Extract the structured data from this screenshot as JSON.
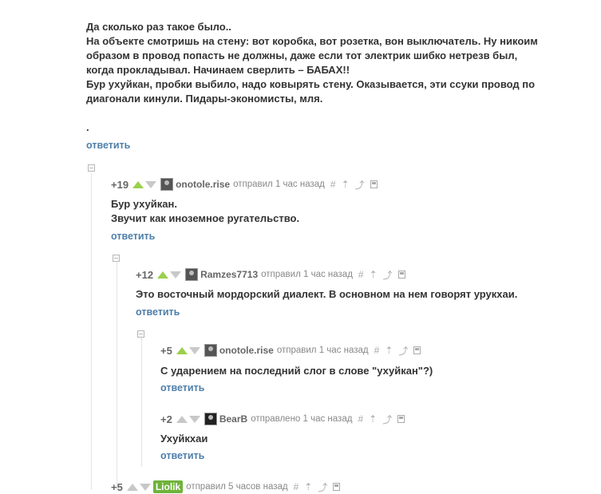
{
  "top_post": {
    "lines": [
      "Да сколько раз такое было..",
      "На объекте смотришь на стену: вот коробка, вот розетка, вон выключатель. Ну никоим",
      "образом в провод попасть не должны, даже если тот электрик шибко нетрезв был,",
      "когда прокладывал. Начинаем сверлить – БАБАХ!!",
      "Бур ухуйкан, пробки выбило, надо ковырять стену. Оказывается, эти ссуки провод по",
      "диагонали кинули. Пидары-экономисты, мля."
    ],
    "dot": ".",
    "reply_label": "ответить"
  },
  "comments": [
    {
      "rating": "+19",
      "username": "onotole.rise",
      "sent_label": "отправил 1 час назад",
      "lines": [
        "Бур ухуйкан.",
        "Звучит как иноземное ругательство."
      ],
      "reply_label": "ответить"
    },
    {
      "rating": "+12",
      "username": "Ramzes7713",
      "sent_label": "отправил 1 час назад",
      "lines": [
        "Это восточный мордорский диалект. В основном на нем говорят урукхаи."
      ],
      "reply_label": "ответить"
    },
    {
      "rating": "+5",
      "username": "onotole.rise",
      "sent_label": "отправил 1 час назад",
      "lines": [
        "С ударением на последний слог в слове \"ухуйкан\"?)"
      ],
      "reply_label": "ответить"
    },
    {
      "rating": "+2",
      "username": "BearB",
      "sent_label": "отправлено 1 час назад",
      "lines": [
        "Ухуйкхаи"
      ],
      "reply_label": "ответить"
    },
    {
      "rating": "+5",
      "username": "Liolik",
      "sent_label": "отправил 5 часов назад"
    }
  ],
  "tools": {
    "hash": "#",
    "arrow_up": "⇡",
    "branch": "⤴"
  },
  "colors": {
    "text": "#333333",
    "link": "#4f7faa",
    "vote_up": "#9bd04d",
    "vote_neutral": "#c8c8c8",
    "username_badge": "#6fb33a"
  }
}
